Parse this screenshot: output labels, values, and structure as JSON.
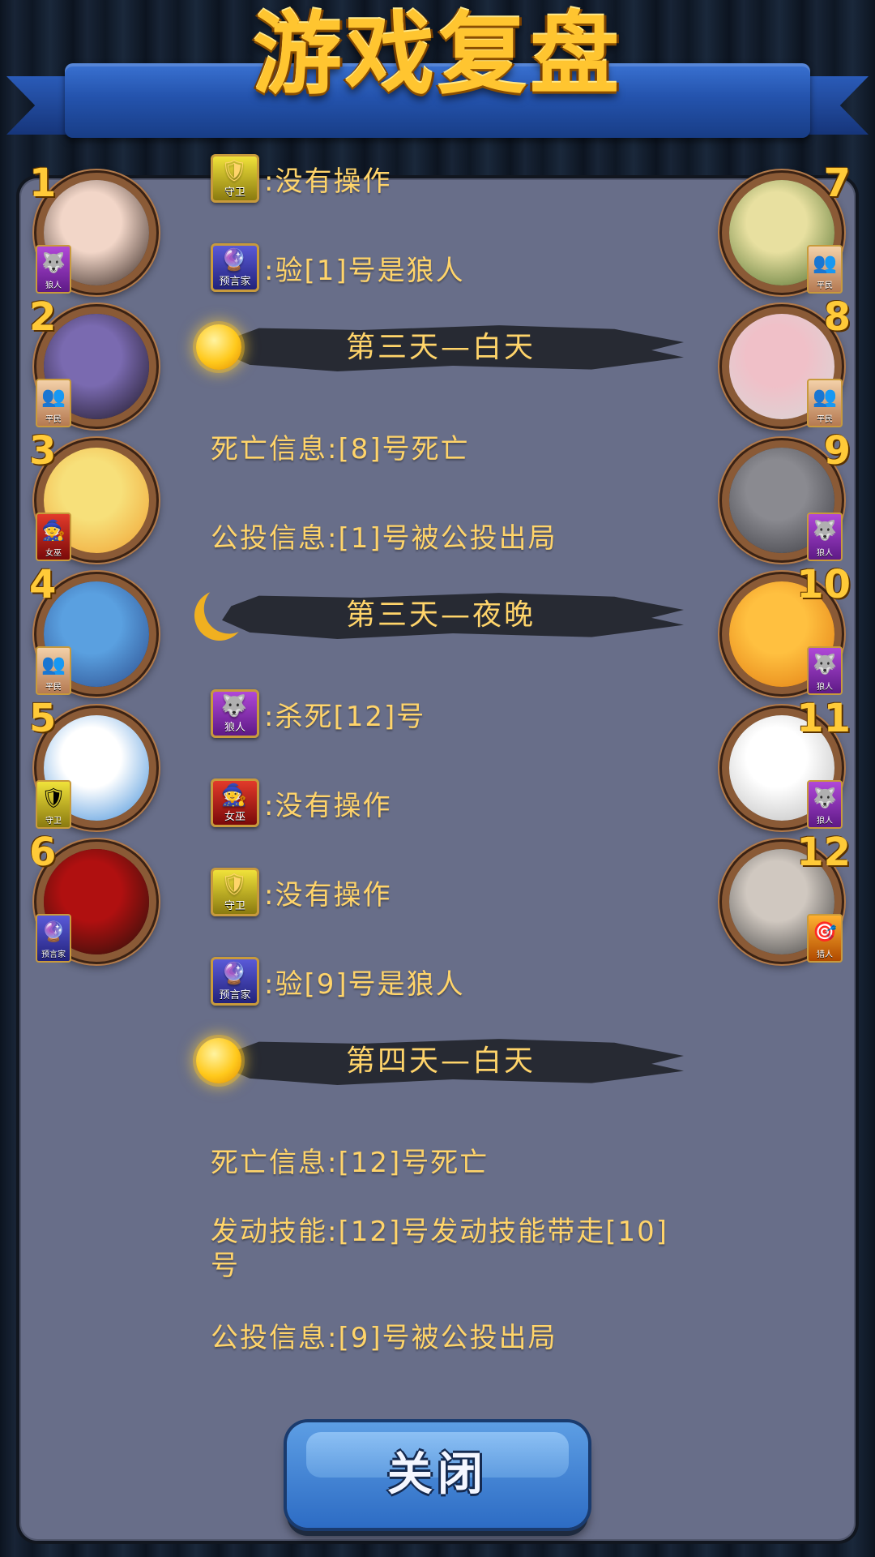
{
  "header": {
    "title": "游戏复盘"
  },
  "players": [
    {
      "num": "1",
      "side": "left",
      "role": "狼人",
      "role_class": "bg-wolf",
      "role_glyph": "🐺",
      "avatar_colors": [
        "#f2d6c8",
        "#2b1d18"
      ]
    },
    {
      "num": "2",
      "side": "left",
      "role": "平民",
      "role_class": "bg-villager",
      "role_glyph": "👥",
      "avatar_colors": [
        "#7a6ab0",
        "#1a1420"
      ]
    },
    {
      "num": "3",
      "side": "left",
      "role": "女巫",
      "role_class": "bg-witch",
      "role_glyph": "🧙",
      "avatar_colors": [
        "#f7e07a",
        "#f0a030"
      ]
    },
    {
      "num": "4",
      "side": "left",
      "role": "平民",
      "role_class": "bg-villager",
      "role_glyph": "👥",
      "avatar_colors": [
        "#5aa0e0",
        "#2a4a8a"
      ]
    },
    {
      "num": "5",
      "side": "left",
      "role": "守卫",
      "role_class": "bg-guard",
      "role_glyph": "🛡",
      "avatar_colors": [
        "#ffffff",
        "#3a8ad8"
      ]
    },
    {
      "num": "6",
      "side": "left",
      "role": "预言家",
      "role_class": "bg-seer",
      "role_glyph": "🔮",
      "avatar_colors": [
        "#b01010",
        "#20100a"
      ]
    },
    {
      "num": "7",
      "side": "right",
      "role": "平民",
      "role_class": "bg-villager",
      "role_glyph": "👥",
      "avatar_colors": [
        "#e8e0a0",
        "#4a6a2a"
      ]
    },
    {
      "num": "8",
      "side": "right",
      "role": "平民",
      "role_class": "bg-villager",
      "role_glyph": "👥",
      "avatar_colors": [
        "#f0c0c8",
        "#d8d8d8"
      ]
    },
    {
      "num": "9",
      "side": "right",
      "role": "狼人",
      "role_class": "bg-wolf",
      "role_glyph": "🐺",
      "avatar_colors": [
        "#8a8a90",
        "#3a3a40"
      ]
    },
    {
      "num": "10",
      "side": "right",
      "role": "狼人",
      "role_class": "bg-wolf",
      "role_glyph": "🐺",
      "avatar_colors": [
        "#ffc040",
        "#e07a10"
      ]
    },
    {
      "num": "11",
      "side": "right",
      "role": "狼人",
      "role_class": "bg-wolf",
      "role_glyph": "🐺",
      "avatar_colors": [
        "#ffffff",
        "#b8b8b8"
      ]
    },
    {
      "num": "12",
      "side": "right",
      "role": "猎人",
      "role_class": "bg-hunter",
      "role_glyph": "🎯",
      "avatar_colors": [
        "#d0c8c0",
        "#3a3a3a"
      ]
    }
  ],
  "log": [
    {
      "kind": "action",
      "role": "守卫",
      "role_class": "bg-guard",
      "role_glyph": "🛡",
      "text": ":没有操作"
    },
    {
      "kind": "action",
      "role": "预言家",
      "role_class": "bg-seer",
      "role_glyph": "🔮",
      "text": ":验[1]号是狼人"
    },
    {
      "kind": "day",
      "phase": "sun",
      "label": "第三天—白天"
    },
    {
      "kind": "text",
      "text": "死亡信息:[8]号死亡"
    },
    {
      "kind": "text",
      "text": "公投信息:[1]号被公投出局"
    },
    {
      "kind": "day",
      "phase": "moon",
      "label": "第三天—夜晚"
    },
    {
      "kind": "action",
      "role": "狼人",
      "role_class": "bg-wolf",
      "role_glyph": "🐺",
      "text": ":杀死[12]号"
    },
    {
      "kind": "action",
      "role": "女巫",
      "role_class": "bg-witch",
      "role_glyph": "🧙",
      "text": ":没有操作"
    },
    {
      "kind": "action",
      "role": "守卫",
      "role_class": "bg-guard",
      "role_glyph": "🛡",
      "text": ":没有操作"
    },
    {
      "kind": "action",
      "role": "预言家",
      "role_class": "bg-seer",
      "role_glyph": "🔮",
      "text": ":验[9]号是狼人"
    },
    {
      "kind": "day",
      "phase": "sun",
      "label": "第四天—白天"
    },
    {
      "kind": "text",
      "text": "死亡信息:[12]号死亡"
    },
    {
      "kind": "text",
      "text": "发动技能:[12]号发动技能带走[10]号"
    },
    {
      "kind": "text",
      "text": "公投信息:[9]号被公投出局"
    }
  ],
  "close_button": {
    "label": "关闭"
  }
}
